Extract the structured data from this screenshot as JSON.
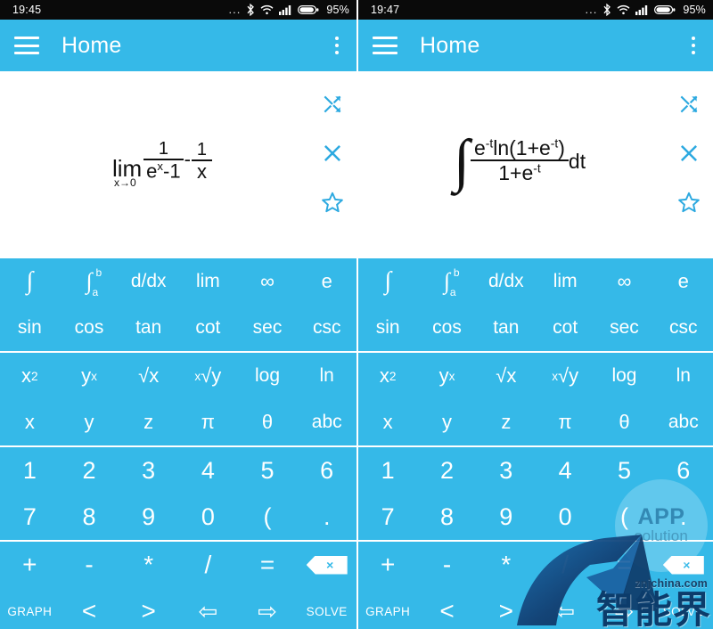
{
  "theme": {
    "accent": "#35b9e8",
    "statusbar_bg": "#0a0a0a",
    "display_bg": "#ffffff",
    "key_text": "#ffffff",
    "expr_text": "#111111"
  },
  "panels": [
    {
      "id": "left",
      "statusbar": {
        "time": "19:45",
        "dots": "...",
        "bluetooth_icon": "bluetooth-icon",
        "wifi_icon": "wifi-icon",
        "signal_icon": "signal-bars-icon",
        "battery_icon": "battery-icon",
        "battery_percent": "95%"
      },
      "appbar": {
        "menu_icon": "hamburger-menu-icon",
        "title": "Home",
        "overflow_icon": "overflow-menu-icon"
      },
      "display": {
        "expression_type": "limit",
        "expression_text": "lim(x→0) 1/(e^x-1) - 1/x",
        "lim_label": "lim",
        "lim_sub": "x→0",
        "frac1_num": "1",
        "frac1_den_base": "e",
        "frac1_den_exp": "x",
        "frac1_den_rest": "-1",
        "minus": "-",
        "frac2_num": "1",
        "frac2_den": "x"
      },
      "actions": [
        {
          "name": "shuffle-arrows-icon",
          "label": "expand"
        },
        {
          "name": "close-icon",
          "label": "clear"
        },
        {
          "name": "star-icon",
          "label": "favorite"
        }
      ],
      "watermarks": []
    },
    {
      "id": "right",
      "statusbar": {
        "time": "19:47",
        "dots": "...",
        "bluetooth_icon": "bluetooth-icon",
        "wifi_icon": "wifi-icon",
        "signal_icon": "signal-bars-icon",
        "battery_icon": "battery-icon",
        "battery_percent": "95%"
      },
      "appbar": {
        "menu_icon": "hamburger-menu-icon",
        "title": "Home",
        "overflow_icon": "overflow-menu-icon"
      },
      "display": {
        "expression_type": "integral",
        "expression_text": "∫ e^-t ln(1+e^-t) / (1+e^-t) dt",
        "integral_sign": "∫",
        "num_e": "e",
        "num_e_exp": "-t",
        "num_ln": "ln(1+e",
        "num_ln_exp": "-t",
        "num_close": ")",
        "den": "1+e",
        "den_exp": "-t",
        "dt": "dt"
      },
      "actions": [
        {
          "name": "shuffle-arrows-icon",
          "label": "expand"
        },
        {
          "name": "close-icon",
          "label": "clear"
        },
        {
          "name": "star-icon",
          "label": "favorite"
        }
      ],
      "watermarks": [
        {
          "name": "app-solution-watermark",
          "line1": "APP",
          "line2": "solution"
        },
        {
          "name": "znjchina-watermark",
          "site": "znjchina.com",
          "cn": "智能界"
        }
      ]
    }
  ],
  "keypad": {
    "groups": [
      {
        "rows": [
          [
            {
              "key": "integral",
              "label": "∫",
              "style": "intg"
            },
            {
              "key": "definite-integral",
              "label": "∫",
              "sub": "a",
              "sup": "b",
              "style": "intab"
            },
            {
              "key": "derivative",
              "label": "d/dx",
              "style": "fn"
            },
            {
              "key": "limit",
              "label": "lim",
              "style": "fn"
            },
            {
              "key": "infinity",
              "label": "∞",
              "style": "sym"
            },
            {
              "key": "euler-e",
              "label": "e",
              "style": "sym"
            }
          ],
          [
            {
              "key": "sin",
              "label": "sin",
              "style": "fn"
            },
            {
              "key": "cos",
              "label": "cos",
              "style": "fn"
            },
            {
              "key": "tan",
              "label": "tan",
              "style": "fn"
            },
            {
              "key": "cot",
              "label": "cot",
              "style": "fn"
            },
            {
              "key": "sec",
              "label": "sec",
              "style": "fn"
            },
            {
              "key": "csc",
              "label": "csc",
              "style": "fn"
            }
          ]
        ]
      },
      {
        "rows": [
          [
            {
              "key": "x-squared",
              "label": "x",
              "sup": "2",
              "style": "sym"
            },
            {
              "key": "y-to-x",
              "label": "y",
              "sup": "x",
              "style": "sym"
            },
            {
              "key": "sqrt-x",
              "label": "√x",
              "style": "sym"
            },
            {
              "key": "nth-root-y",
              "label": "√y",
              "pre": "x",
              "style": "sym"
            },
            {
              "key": "log",
              "label": "log",
              "style": "fn"
            },
            {
              "key": "ln",
              "label": "ln",
              "style": "fn"
            }
          ],
          [
            {
              "key": "var-x",
              "label": "x",
              "style": "sym"
            },
            {
              "key": "var-y",
              "label": "y",
              "style": "sym"
            },
            {
              "key": "var-z",
              "label": "z",
              "style": "sym"
            },
            {
              "key": "pi",
              "label": "π",
              "style": "sym"
            },
            {
              "key": "theta",
              "label": "θ",
              "style": "sym"
            },
            {
              "key": "abc",
              "label": "abc",
              "style": "fn"
            }
          ]
        ]
      },
      {
        "rows": [
          [
            {
              "key": "digit-1",
              "label": "1",
              "style": "num"
            },
            {
              "key": "digit-2",
              "label": "2",
              "style": "num"
            },
            {
              "key": "digit-3",
              "label": "3",
              "style": "num"
            },
            {
              "key": "digit-4",
              "label": "4",
              "style": "num"
            },
            {
              "key": "digit-5",
              "label": "5",
              "style": "num"
            },
            {
              "key": "digit-6",
              "label": "6",
              "style": "num"
            }
          ],
          [
            {
              "key": "digit-7",
              "label": "7",
              "style": "num"
            },
            {
              "key": "digit-8",
              "label": "8",
              "style": "num"
            },
            {
              "key": "digit-9",
              "label": "9",
              "style": "num"
            },
            {
              "key": "digit-0",
              "label": "0",
              "style": "num"
            },
            {
              "key": "paren-open",
              "label": "(",
              "style": "num"
            },
            {
              "key": "decimal-point",
              "label": ".",
              "style": "num"
            }
          ]
        ]
      },
      {
        "rows": [
          [
            {
              "key": "plus",
              "label": "+",
              "style": "op"
            },
            {
              "key": "minus",
              "label": "-",
              "style": "op"
            },
            {
              "key": "multiply",
              "label": "*",
              "style": "op"
            },
            {
              "key": "divide",
              "label": "/",
              "style": "op"
            },
            {
              "key": "equals",
              "label": "=",
              "style": "op"
            },
            {
              "key": "backspace",
              "label": "×",
              "style": "bksp"
            }
          ],
          [
            {
              "key": "graph",
              "label": "GRAPH",
              "style": "lbl"
            },
            {
              "key": "less-than",
              "label": "<",
              "style": "op"
            },
            {
              "key": "greater-than",
              "label": ">",
              "style": "op"
            },
            {
              "key": "cursor-left",
              "label": "⇦",
              "style": "arrow"
            },
            {
              "key": "cursor-right",
              "label": "⇨",
              "style": "arrow"
            },
            {
              "key": "solve",
              "label": "SOLVE",
              "style": "lbl"
            }
          ]
        ]
      }
    ]
  }
}
